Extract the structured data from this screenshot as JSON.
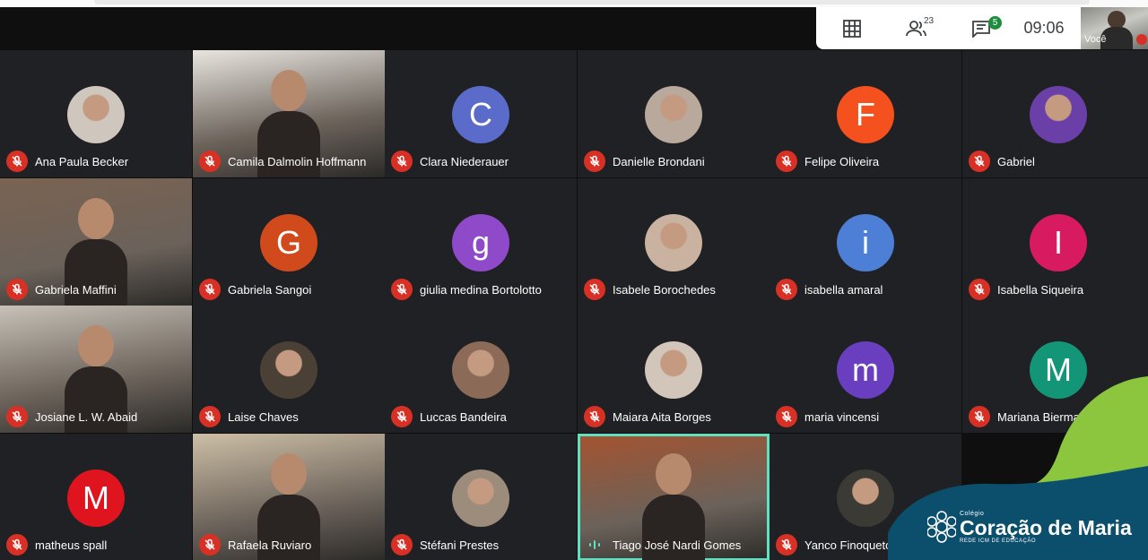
{
  "toolbar": {
    "participants_count": "23",
    "chat_badge": "5",
    "clock": "09:06",
    "self_label": "Você"
  },
  "participants": [
    {
      "name": "Ana Paula Becker",
      "kind": "photo",
      "color": "#cfc7bd",
      "initial": ""
    },
    {
      "name": "Camila Dalmolin Hoffmann",
      "kind": "video",
      "color": "#e8e5e0",
      "initial": ""
    },
    {
      "name": "Clara Niederauer",
      "kind": "letter",
      "color": "#5a6bc9",
      "initial": "C"
    },
    {
      "name": "Danielle Brondani",
      "kind": "photo",
      "color": "#b9a89c",
      "initial": ""
    },
    {
      "name": "Felipe Oliveira",
      "kind": "letter",
      "color": "#f4511e",
      "initial": "F"
    },
    {
      "name": "Gabriel",
      "kind": "photo",
      "color": "#6b3fa8",
      "initial": ""
    },
    {
      "name": "Gabriela Maffini",
      "kind": "video",
      "color": "#7a6352",
      "initial": ""
    },
    {
      "name": "Gabriela Sangoi",
      "kind": "letter",
      "color": "#d04a1c",
      "initial": "G"
    },
    {
      "name": "giulia medina Bortolotto",
      "kind": "letter",
      "color": "#8e4ac9",
      "initial": "g"
    },
    {
      "name": "Isabele Borochedes",
      "kind": "photo",
      "color": "#c9b3a0",
      "initial": ""
    },
    {
      "name": "isabella amaral",
      "kind": "letter",
      "color": "#4d7fd6",
      "initial": "i"
    },
    {
      "name": "Isabella Siqueira",
      "kind": "letter",
      "color": "#d81b60",
      "initial": "I"
    },
    {
      "name": "Josiane L. W. Abaid",
      "kind": "video",
      "color": "#c7c1b8",
      "initial": ""
    },
    {
      "name": "Laise Chaves",
      "kind": "photo",
      "color": "#4a4036",
      "initial": ""
    },
    {
      "name": "Luccas Bandeira",
      "kind": "photo",
      "color": "#8c6a58",
      "initial": ""
    },
    {
      "name": "Maiara Aita Borges",
      "kind": "photo",
      "color": "#d2c6bb",
      "initial": ""
    },
    {
      "name": "maria vincensi",
      "kind": "letter",
      "color": "#6a3fbf",
      "initial": "m"
    },
    {
      "name": "Mariana Bierma",
      "kind": "letter",
      "color": "#139677",
      "initial": "M"
    },
    {
      "name": "matheus spall",
      "kind": "letter",
      "color": "#e0141e",
      "initial": "M"
    },
    {
      "name": "Rafaela Ruviaro",
      "kind": "video",
      "color": "#cdbfa6",
      "initial": ""
    },
    {
      "name": "Stéfani Prestes",
      "kind": "photo",
      "color": "#9c8c7c",
      "initial": ""
    },
    {
      "name": "Tiago José Nardi Gomes",
      "kind": "video",
      "color": "#a5532f",
      "initial": "",
      "active": true
    },
    {
      "name": "Yanco Finoqueto",
      "kind": "photo",
      "color": "#3b3a34",
      "initial": ""
    }
  ],
  "brand": {
    "small": "Colégio",
    "big": "Coração de Maria",
    "sub": "REDE ICM DE EDUCAÇÃO"
  }
}
